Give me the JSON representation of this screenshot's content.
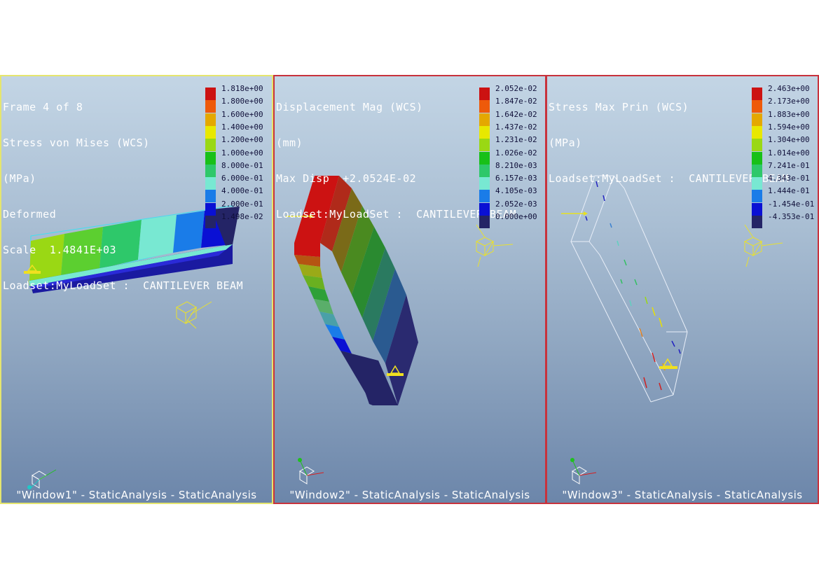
{
  "colors": {
    "active_border": "#e5e56e",
    "inactive_border": "#c8323c",
    "fringe": [
      "#cc1212",
      "#ee5a0a",
      "#e4a800",
      "#e8e800",
      "#9ad814",
      "#18c018",
      "#2ec86a",
      "#78e8d2",
      "#1a7ce8",
      "#0a10d4",
      "#242466"
    ]
  },
  "windows": [
    {
      "id": "w1",
      "active": true,
      "info": [
        "Frame 4 of 8",
        "Stress von Mises (WCS)",
        "(MPa)",
        "Deformed",
        "Scale  1.4841E+03",
        "Loadset:MyLoadSet :  CANTILEVER BEAM"
      ],
      "legend": [
        "1.818e+00",
        "1.800e+00",
        "1.600e+00",
        "1.400e+00",
        "1.200e+00",
        "1.000e+00",
        "8.000e-01",
        "6.000e-01",
        "4.000e-01",
        "2.000e-01",
        "1.498e-02"
      ],
      "caption": "\"Window1\" - StaticAnalysis - StaticAnalysis"
    },
    {
      "id": "w2",
      "active": false,
      "info": [
        "Displacement Mag (WCS)",
        "(mm)",
        "Max Disp  +2.0524E-02",
        "Loadset:MyLoadSet :  CANTILEVER BEAM"
      ],
      "legend": [
        "2.052e-02",
        "1.847e-02",
        "1.642e-02",
        "1.437e-02",
        "1.231e-02",
        "1.026e-02",
        "8.210e-03",
        "6.157e-03",
        "4.105e-03",
        "2.052e-03",
        "0.000e+00"
      ],
      "caption": "\"Window2\" - StaticAnalysis - StaticAnalysis"
    },
    {
      "id": "w3",
      "active": false,
      "info": [
        "Stress Max Prin (WCS)",
        "(MPa)",
        "Loadset:MyLoadSet :  CANTILEVER BEAM"
      ],
      "legend": [
        "2.463e+00",
        "2.173e+00",
        "1.883e+00",
        "1.594e+00",
        "1.304e+00",
        "1.014e+00",
        "7.241e-01",
        "4.343e-01",
        "1.444e-01",
        "-1.454e-01",
        "-4.353e-01"
      ],
      "caption": "\"Window3\" - StaticAnalysis - StaticAnalysis"
    }
  ]
}
